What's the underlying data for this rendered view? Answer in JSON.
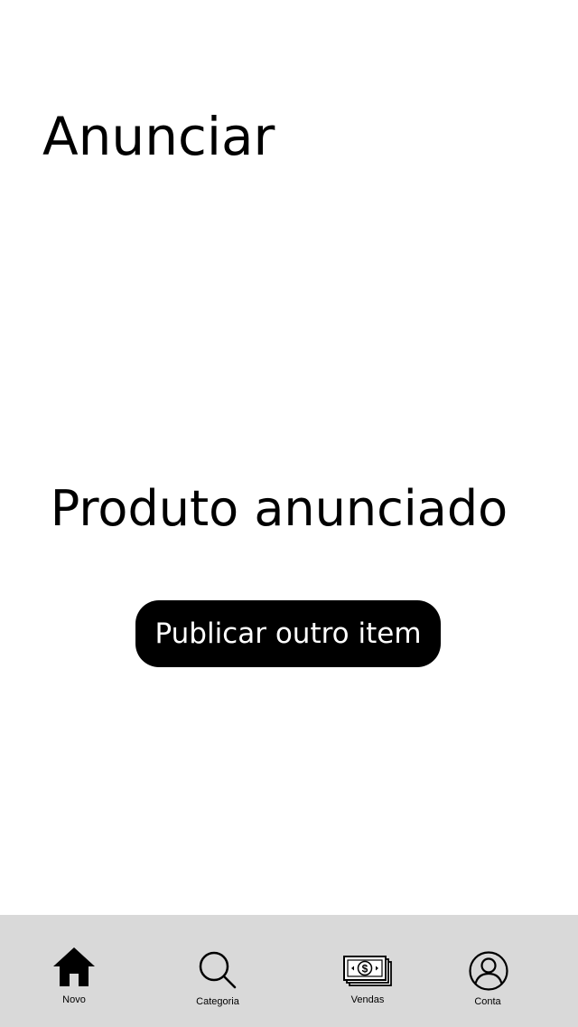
{
  "header": {
    "title": "Anunciar"
  },
  "main": {
    "message": "Produto anunciado",
    "publish_button_label": "Publicar outro item"
  },
  "bottom_nav": {
    "background": "#d9d9d9",
    "items": [
      {
        "label": "Novo",
        "icon": "home-icon"
      },
      {
        "label": "Categoria",
        "icon": "search-icon"
      },
      {
        "label": "Vendas",
        "icon": "money-icon"
      },
      {
        "label": "Conta",
        "icon": "user-icon"
      }
    ]
  },
  "colors": {
    "button_background": "#000000",
    "button_text": "#ffffff"
  }
}
